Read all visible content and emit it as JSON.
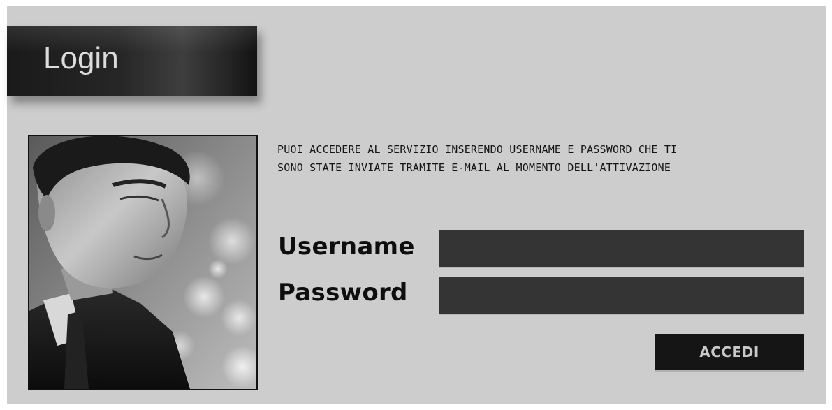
{
  "header": {
    "title": "Login"
  },
  "info": {
    "line1": "PUOI ACCEDERE AL SERVIZIO INSERENDO USERNAME E PASSWORD CHE TI",
    "line2": "SONO STATE INVIATE TRAMITE E-MAIL AL MOMENTO DELL'ATTIVAZIONE"
  },
  "form": {
    "username_label": "Username",
    "username_value": "",
    "password_label": "Password",
    "password_value": "",
    "submit_label": "ACCEDI"
  },
  "colors": {
    "panel_background": "#cdcdcd",
    "banner": "#1f1f1f",
    "input_background": "#343434",
    "button_background": "#151515",
    "button_text": "#c9c9c9"
  },
  "image": {
    "icon": "portrait-photo"
  }
}
